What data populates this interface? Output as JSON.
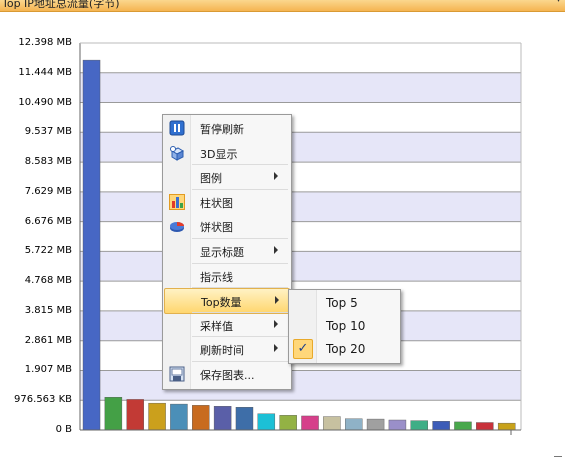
{
  "window": {
    "title": "Top IP地址总流量(字节)",
    "dropdown_icon": "chevron-down-icon"
  },
  "chart_data": {
    "type": "bar",
    "ylim": [
      0,
      12.398
    ],
    "y_unit": "MB",
    "yticks": [
      "0 B",
      "976.563 KB",
      "1.907 MB",
      "2.861 MB",
      "3.815 MB",
      "4.768 MB",
      "5.722 MB",
      "6.676 MB",
      "7.629 MB",
      "8.583 MB",
      "9.537 MB",
      "10.490 MB",
      "11.444 MB",
      "12.398 MB"
    ],
    "ytick_values": [
      0,
      0.954,
      1.907,
      2.861,
      3.815,
      4.768,
      5.722,
      6.676,
      7.629,
      8.583,
      9.537,
      10.49,
      11.444,
      12.398
    ],
    "grid_bands": true,
    "values": [
      11.85,
      1.05,
      0.98,
      0.86,
      0.83,
      0.79,
      0.76,
      0.73,
      0.52,
      0.47,
      0.45,
      0.43,
      0.36,
      0.35,
      0.32,
      0.3,
      0.28,
      0.26,
      0.24,
      0.22
    ],
    "colors": [
      "#4767c4",
      "#44a046",
      "#c23a35",
      "#cba01c",
      "#4b8fb8",
      "#c86b1f",
      "#5a5fa8",
      "#3e6ea8",
      "#1cc0d6",
      "#93b244",
      "#d63f8a",
      "#c7c1a0",
      "#8fb2c7",
      "#a0a0a0",
      "#9a8fc9",
      "#3fae86",
      "#3c5cb8",
      "#49a84c",
      "#c8323b",
      "#c8a21a"
    ]
  },
  "context_menu": {
    "items": [
      {
        "label": "暂停刷新",
        "icon": "pause-refresh-icon",
        "submenu": false
      },
      {
        "label": "3D显示",
        "icon": "3d-cube-icon",
        "submenu": false
      },
      {
        "label": "图例",
        "icon": "",
        "submenu": true
      },
      {
        "label": "柱状图",
        "icon": "bar-chart-icon",
        "submenu": false
      },
      {
        "label": "饼状图",
        "icon": "pie-chart-icon",
        "submenu": false
      },
      {
        "label": "显示标题",
        "icon": "",
        "submenu": true
      },
      {
        "label": "指示线",
        "icon": "",
        "submenu": false
      },
      {
        "label": "Top数量",
        "icon": "",
        "submenu": true,
        "highlighted": true
      },
      {
        "label": "采样值",
        "icon": "",
        "submenu": true
      },
      {
        "label": "刷新时间",
        "icon": "",
        "submenu": true
      },
      {
        "label": "保存图表...",
        "icon": "save-chart-icon",
        "submenu": false
      }
    ]
  },
  "top_submenu": {
    "items": [
      {
        "label": "Top 5",
        "checked": false
      },
      {
        "label": "Top 10",
        "checked": false
      },
      {
        "label": "Top 20",
        "checked": true
      }
    ],
    "check_glyph": "✓"
  }
}
